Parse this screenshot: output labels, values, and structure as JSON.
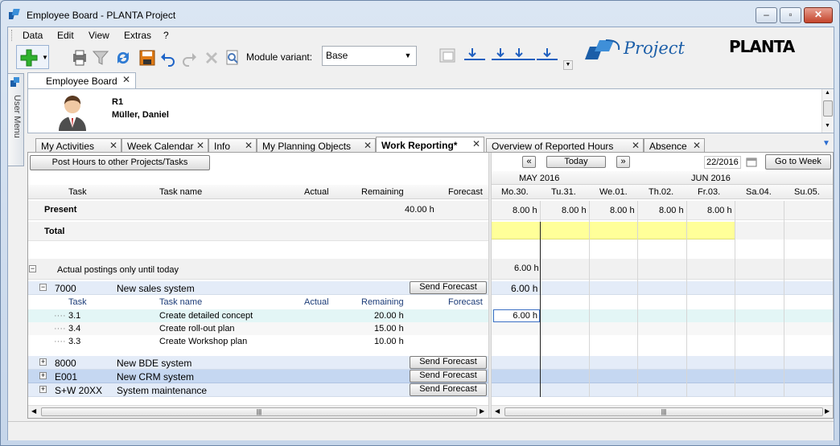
{
  "window": {
    "title": "Employee Board - PLANTA Project"
  },
  "menu": [
    "Data",
    "Edit",
    "View",
    "Extras",
    "?"
  ],
  "toolbar": {
    "module_variant_label": "Module variant:",
    "module_variant_value": "Base"
  },
  "branding": {
    "project_text": "Project",
    "planta_text": "PLANTA"
  },
  "side_tab": {
    "label": "User Menu"
  },
  "doc_tab": {
    "label": "Employee Board"
  },
  "employee": {
    "id": "R1",
    "name": "Müller, Daniel"
  },
  "subtabs": [
    {
      "label": "My Activities",
      "active": false
    },
    {
      "label": "Week Calendar",
      "active": false
    },
    {
      "label": "Info",
      "active": false
    },
    {
      "label": "My Planning Objects",
      "active": false
    },
    {
      "label": "Work Reporting*",
      "active": true
    },
    {
      "label": "Overview of Reported Hours",
      "active": false
    },
    {
      "label": "Absence",
      "active": false
    }
  ],
  "left": {
    "post_hours_button": "Post Hours to other Projects/Tasks",
    "columns": {
      "task": "Task",
      "task_name": "Task name",
      "actual": "Actual",
      "remaining": "Remaining",
      "forecast": "Forecast"
    },
    "present_label": "Present",
    "present_remaining": "40.00 h",
    "total_label": "Total",
    "actual_postings_label": "Actual postings only until today",
    "send_forecast": "Send Forecast",
    "projects": [
      {
        "id": "7000",
        "name": "New sales system",
        "expanded": true
      },
      {
        "id": "8000",
        "name": "New BDE system",
        "expanded": false
      },
      {
        "id": "E001",
        "name": "New CRM system",
        "expanded": false
      },
      {
        "id": "S+W 20XX",
        "name": "System maintenance",
        "expanded": false
      }
    ],
    "tasks": [
      {
        "task": "3.1",
        "name": "Create detailed concept",
        "remaining": "20.00 h"
      },
      {
        "task": "3.4",
        "name": "Create roll-out plan",
        "remaining": "15.00 h"
      },
      {
        "task": "3.3",
        "name": "Create Workshop plan",
        "remaining": "10.00 h"
      }
    ]
  },
  "calendar": {
    "prev": "«",
    "today": "Today",
    "next": "»",
    "week_value": "22/2016",
    "go_to_week": "Go to Week",
    "month_may": "MAY 2016",
    "month_jun": "JUN 2016",
    "days": [
      "Mo.30.",
      "Tu.31.",
      "We.01.",
      "Th.02.",
      "Fr.03.",
      "Sa.04.",
      "Su.05."
    ],
    "present_hours": [
      "8.00 h",
      "8.00 h",
      "8.00 h",
      "8.00 h",
      "8.00 h",
      "",
      ""
    ],
    "actual_postings_value": "6.00 h",
    "project_7000_value": "6.00 h",
    "task_31_value": "6.00 h"
  },
  "colors": {
    "total_highlight": "#ffff99",
    "selected_row": "#c5d7f1",
    "project_row": "#e4ecf8",
    "task_highlight": "#e3f6f6"
  }
}
